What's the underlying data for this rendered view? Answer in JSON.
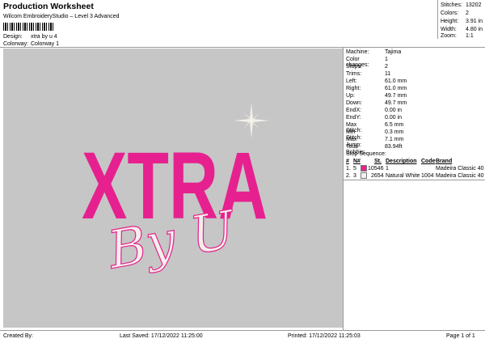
{
  "header": {
    "title": "Production Worksheet",
    "subtitle": "Wilcom EmbroideryStudio – Level 3 Advanced",
    "design_label": "Design:",
    "design_value": "xtra by u 4",
    "colorway_label": "Colorway:",
    "colorway_value": "Colorway 1"
  },
  "stats": [
    {
      "label": "Stitches:",
      "value": "13202"
    },
    {
      "label": "Colors:",
      "value": "2"
    },
    {
      "label": "Height:",
      "value": "3.91 in"
    },
    {
      "label": "Width:",
      "value": "4.80 in"
    },
    {
      "label": "Zoom:",
      "value": "1:1"
    }
  ],
  "machine_info": [
    {
      "label": "Machine:",
      "value": "Tajima"
    },
    {
      "label": "Color changes:",
      "value": "1"
    },
    {
      "label": "Stops:",
      "value": "2"
    },
    {
      "label": "Trims:",
      "value": "11"
    },
    {
      "label": "Left:",
      "value": "61.0 mm"
    },
    {
      "label": "Right:",
      "value": "61.0 mm"
    },
    {
      "label": "Up:",
      "value": "49.7 mm"
    },
    {
      "label": "Down:",
      "value": "49.7 mm"
    },
    {
      "label": "EndX:",
      "value": "0.00 in"
    },
    {
      "label": "EndY:",
      "value": "0.00 in"
    },
    {
      "label": "Max Stitch:",
      "value": "6.5 mm"
    },
    {
      "label": "Min Stitch:",
      "value": "0.3 mm"
    },
    {
      "label": "Max Jump:",
      "value": "7.1 mm"
    },
    {
      "label": "Total Bobbin:",
      "value": "83.94ft"
    }
  ],
  "stop_sequence": {
    "title": "Stop Sequence:",
    "headers": {
      "num": "#",
      "n": "N#",
      "st": "St.",
      "description": "Description",
      "code": "Code",
      "brand": "Brand"
    },
    "rows": [
      {
        "num": "1.",
        "n": "5",
        "color": "#e6218f",
        "st": "10546",
        "description": "1",
        "code": "",
        "brand": "Madeira Classic 40"
      },
      {
        "num": "2.",
        "n": "3",
        "color": "#f2f0ec",
        "st": "2654",
        "description": "Natural White",
        "code": "1004",
        "brand": "Madeira Classic 40"
      }
    ]
  },
  "design_preview": {
    "main_text": "XTRA",
    "script_text": "By U",
    "main_color": "#e6218f",
    "script_color": "#f4f0ea"
  },
  "footer": {
    "created_by": "Created By:",
    "last_saved": "Last Saved: 17/12/2022 11:25:00",
    "printed": "Printed: 17/12/2022 11:25:03",
    "page": "Page 1 of 1"
  }
}
